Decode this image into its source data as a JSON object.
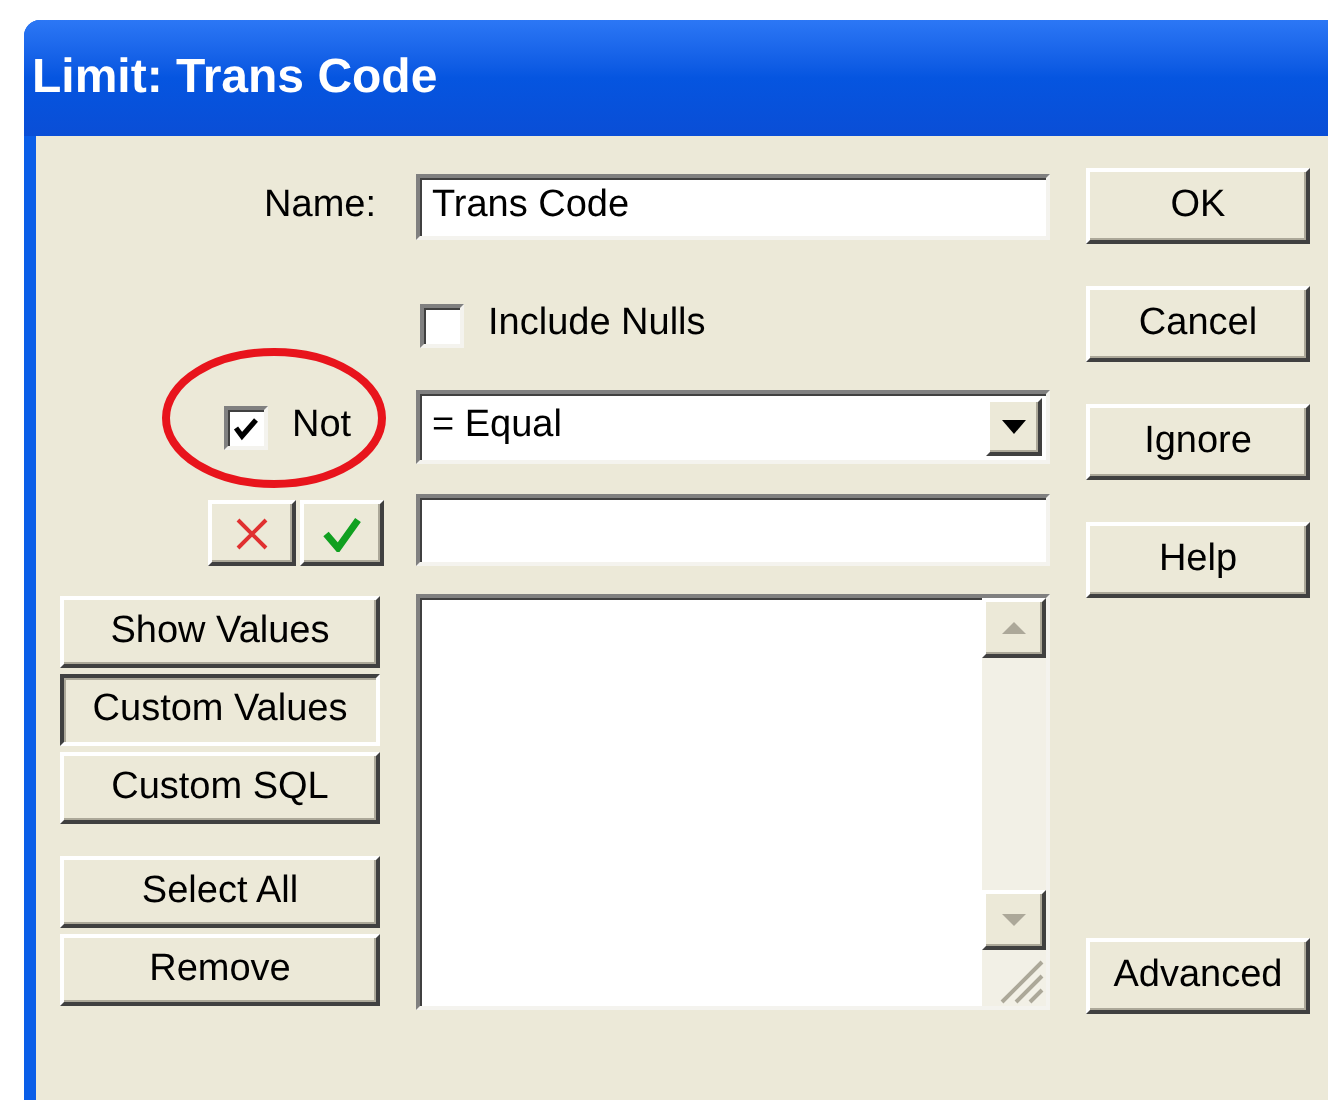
{
  "window": {
    "title": "Limit: Trans Code"
  },
  "name": {
    "label": "Name:",
    "value": "Trans Code"
  },
  "include_nulls": {
    "label": "Include Nulls",
    "checked": false
  },
  "not": {
    "label": "Not",
    "checked": true
  },
  "operator": {
    "value": "= Equal"
  },
  "mode_buttons": [
    {
      "label": "Show Values",
      "selected": false
    },
    {
      "label": "Custom Values",
      "selected": true
    },
    {
      "label": "Custom SQL",
      "selected": false
    }
  ],
  "list_buttons": [
    "Select All",
    "Remove"
  ],
  "action_buttons": [
    "OK",
    "Cancel",
    "Ignore",
    "Help"
  ],
  "advanced_button": "Advanced"
}
